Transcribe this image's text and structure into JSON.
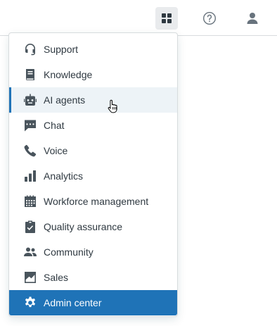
{
  "header": {
    "apps_icon": "grid-icon",
    "help_icon": "help-icon",
    "profile_icon": "user-icon"
  },
  "menu": {
    "items": [
      {
        "label": "Support",
        "icon": "headset-icon",
        "state": "default"
      },
      {
        "label": "Knowledge",
        "icon": "book-icon",
        "state": "default"
      },
      {
        "label": "AI agents",
        "icon": "robot-icon",
        "state": "hover"
      },
      {
        "label": "Chat",
        "icon": "chat-icon",
        "state": "default"
      },
      {
        "label": "Voice",
        "icon": "phone-icon",
        "state": "default"
      },
      {
        "label": "Analytics",
        "icon": "bar-chart-icon",
        "state": "default"
      },
      {
        "label": "Workforce management",
        "icon": "calendar-icon",
        "state": "default"
      },
      {
        "label": "Quality assurance",
        "icon": "clipboard-check-icon",
        "state": "default"
      },
      {
        "label": "Community",
        "icon": "people-icon",
        "state": "default"
      },
      {
        "label": "Sales",
        "icon": "trend-chart-icon",
        "state": "default"
      },
      {
        "label": "Admin center",
        "icon": "gear-icon",
        "state": "selected"
      }
    ]
  },
  "colors": {
    "accent": "#1f73b7",
    "hover_bg": "#edf3f7",
    "text": "#2f3941",
    "icon": "#49545c",
    "border": "#d8dcde"
  }
}
